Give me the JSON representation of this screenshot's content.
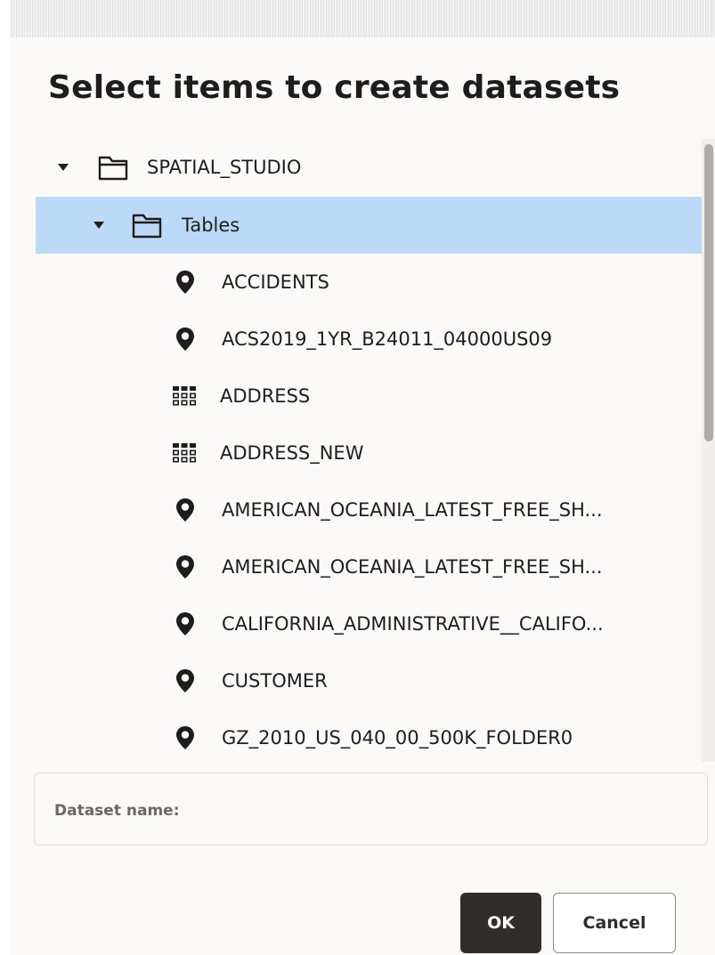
{
  "dialog": {
    "title": "Select items to create datasets"
  },
  "tree": {
    "root": {
      "label": "SPATIAL_STUDIO",
      "icon": "folder-icon",
      "expanded": true
    },
    "folder": {
      "label": "Tables",
      "icon": "folder-icon",
      "expanded": true,
      "selected": true
    },
    "items": [
      {
        "label": "ACCIDENTS",
        "icon": "map-pin-icon"
      },
      {
        "label": "ACS2019_1YR_B24011_04000US09",
        "icon": "map-pin-icon"
      },
      {
        "label": "ADDRESS",
        "icon": "table-grid-icon"
      },
      {
        "label": "ADDRESS_NEW",
        "icon": "table-grid-icon"
      },
      {
        "label": "AMERICAN_OCEANIA_LATEST_FREE_SH...",
        "icon": "map-pin-icon"
      },
      {
        "label": "AMERICAN_OCEANIA_LATEST_FREE_SH...",
        "icon": "map-pin-icon"
      },
      {
        "label": "CALIFORNIA_ADMINISTRATIVE__CALIFO...",
        "icon": "map-pin-icon"
      },
      {
        "label": "CUSTOMER",
        "icon": "map-pin-icon"
      },
      {
        "label": "GZ_2010_US_040_00_500K_FOLDER0",
        "icon": "map-pin-icon"
      }
    ]
  },
  "dataset": {
    "name_label": "Dataset name:",
    "name_value": ""
  },
  "buttons": {
    "ok": "OK",
    "cancel": "Cancel"
  },
  "colors": {
    "selected_row": "#bcdaf7",
    "primary_button": "#312d2a",
    "dialog_background": "#fbfaf8"
  }
}
